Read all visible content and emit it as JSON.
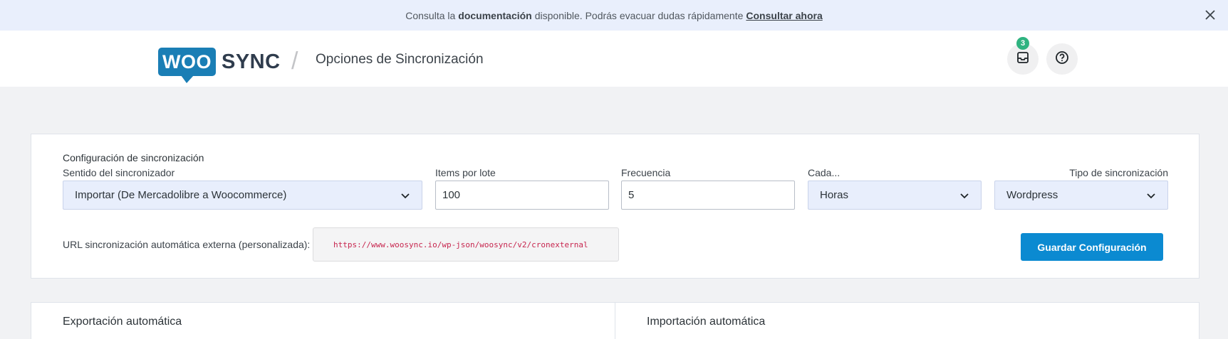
{
  "notice": {
    "prefix": "Consulta la",
    "bold": "documentación",
    "middle": "disponible. Podrás evacuar dudas rápidamente",
    "link": "Consultar ahora"
  },
  "header": {
    "logo_woo": "WOO",
    "logo_sync": "SYNC",
    "separator": "/",
    "title": "Opciones de Sincronización",
    "inbox_count": "3"
  },
  "config": {
    "section_title": "Configuración de sincronización",
    "direction_label": "Sentido del sincronizador",
    "direction_value": "Importar (De Mercadolibre a Woocommerce)",
    "batch_label": "Items por lote",
    "batch_value": "100",
    "frequency_label": "Frecuencia",
    "frequency_value": "5",
    "every_label": "Cada...",
    "every_value": "Horas",
    "type_label": "Tipo de sincronización",
    "type_value": "Wordpress",
    "url_label": "URL sincronización automática externa (personalizada):",
    "url_value": "https://www.woosync.io/wp-json/woosync/v2/cronexternal",
    "save_label": "Guardar Configuración"
  },
  "panels": {
    "export_title": "Exportación automática",
    "import_title": "Importación automática"
  },
  "colors": {
    "accent": "#0b8ad1",
    "brand": "#1a7eb5",
    "badge": "#2fb380",
    "notice_bg": "#e9effc"
  }
}
